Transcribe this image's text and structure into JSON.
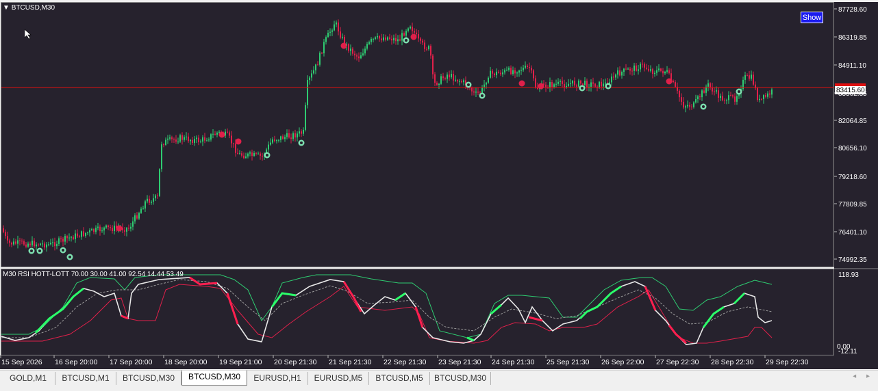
{
  "chart": {
    "symbol_label": "BTCUSD,M30",
    "show_button": "Show",
    "current_price": "83415.60",
    "price_levels": [
      "87728.60",
      "86319.85",
      "84911.10",
      "83502.35",
      "82064.85",
      "80656.10",
      "79218.60",
      "77809.85",
      "76401.10",
      "74992.35"
    ],
    "time_labels": [
      "15 Sep 2026",
      "16 Sep 20:00",
      "17 Sep 20:00",
      "18 Sep 20:00",
      "19 Sep 21:00",
      "20 Sep 21:30",
      "21 Sep 21:30",
      "22 Sep 21:30",
      "23 Sep 21:30",
      "24 Sep 21:30",
      "25 Sep 21:30",
      "26 Sep 22:00",
      "27 Sep 22:30",
      "28 Sep 22:30",
      "29 Sep 22:30"
    ],
    "colors": {
      "background": "#26222d",
      "bull": "#2ecc71",
      "bear": "#e0204a",
      "hline": "#e01010"
    }
  },
  "indicator": {
    "label": "M30 RSI HOTT-LOTT  70.00 30.00 41.00 92.54 14.44 53.49",
    "scale_top": "118.93",
    "scale_zero": "0.00",
    "scale_bottom": "-12.11"
  },
  "tabs": [
    {
      "label": "GOLD,M1",
      "active": false
    },
    {
      "label": "BTCUSD,M1",
      "active": false
    },
    {
      "label": "BTCUSD,M30",
      "active": false
    },
    {
      "label": "BTCUSD,M30",
      "active": true
    },
    {
      "label": "EURUSD,H1",
      "active": false
    },
    {
      "label": "EURUSD,M5",
      "active": false
    },
    {
      "label": "BTCUSD,M5",
      "active": false
    },
    {
      "label": "BTCUSD,M30",
      "active": false
    }
  ],
  "tab_scroll": {
    "left": "◂",
    "right": "▸"
  }
}
